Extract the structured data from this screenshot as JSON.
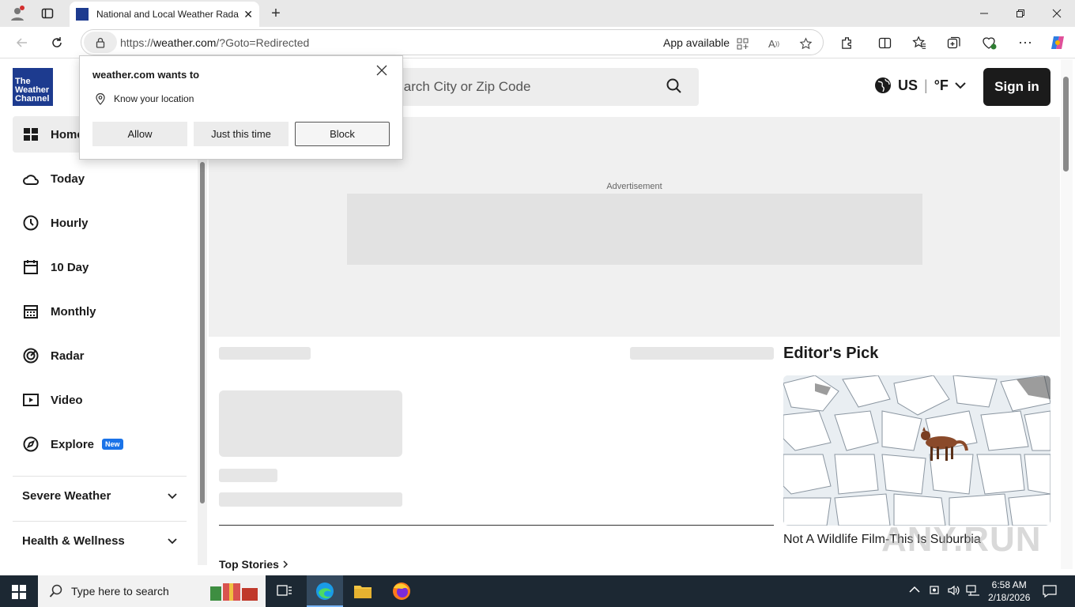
{
  "browser": {
    "tab_title": "National and Local Weather Rada",
    "url_prefix": "https://",
    "url_host": "weather.com",
    "url_path": "/?Goto=Redirected",
    "app_available": "App available"
  },
  "popup": {
    "title": "weather.com wants to",
    "permission": "Know your location",
    "allow": "Allow",
    "just_this_time": "Just this time",
    "block": "Block"
  },
  "header": {
    "logo_line1": "The",
    "logo_line2": "Weather",
    "logo_line3": "Channel",
    "search_placeholder": "Search City or Zip Code",
    "region": "US",
    "unit": "°F",
    "sign_in": "Sign in"
  },
  "sidebar": {
    "items": [
      {
        "label": "Home"
      },
      {
        "label": "Today"
      },
      {
        "label": "Hourly"
      },
      {
        "label": "10 Day"
      },
      {
        "label": "Monthly"
      },
      {
        "label": "Radar"
      },
      {
        "label": "Video"
      },
      {
        "label": "Explore",
        "badge": "New"
      }
    ],
    "sections": [
      {
        "label": "Severe Weather"
      },
      {
        "label": "Health & Wellness"
      }
    ]
  },
  "main": {
    "ad_label": "Advertisement",
    "editors_pick_title": "Editor's Pick",
    "editors_pick_caption": "Not A Wildlife Film-This Is Suburbia",
    "top_stories": "Top Stories"
  },
  "taskbar": {
    "search_placeholder": "Type here to search",
    "time": "6:58 AM",
    "date": "2/18/2026"
  },
  "watermark": "ANY.RUN",
  "colors": {
    "brand_blue": "#1d3b8f",
    "new_badge": "#1a73e8",
    "sign_in_bg": "#1b1b1b"
  }
}
